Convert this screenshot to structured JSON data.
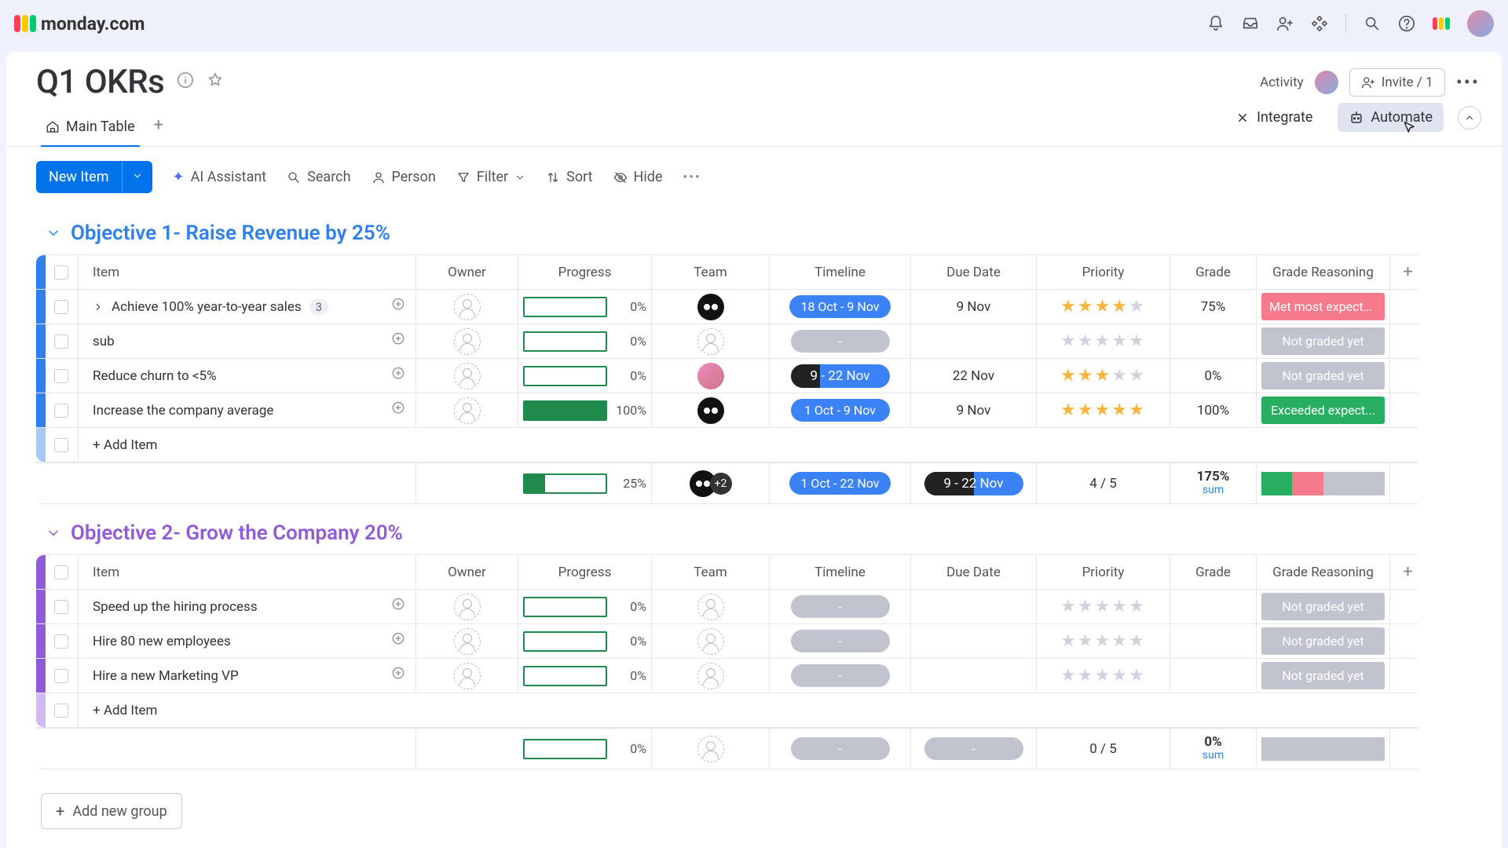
{
  "brand": "monday.com",
  "board": {
    "title": "Q1 OKRs"
  },
  "header": {
    "activity": "Activity",
    "invite": "Invite / 1"
  },
  "tabs": {
    "main": "Main Table",
    "integrate": "Integrate",
    "automate": "Automate"
  },
  "toolbar": {
    "newitem": "New Item",
    "ai": "AI Assistant",
    "search": "Search",
    "person": "Person",
    "filter": "Filter",
    "sort": "Sort",
    "hide": "Hide"
  },
  "cols": {
    "item": "Item",
    "owner": "Owner",
    "progress": "Progress",
    "team": "Team",
    "timeline": "Timeline",
    "due": "Due Date",
    "priority": "Priority",
    "grade": "Grade",
    "reason": "Grade Reasoning"
  },
  "groups": [
    {
      "title": "Objective 1- Raise Revenue by 25%",
      "color": "blue",
      "rows": [
        {
          "name": "Achieve 100% year-to-year sales",
          "sub": "3",
          "expand": true,
          "progress": 0,
          "team": "group",
          "timeline": "18 Oct - 9 Nov",
          "tl_style": "blue",
          "due": "9 Nov",
          "stars": 4,
          "grade": "75%",
          "reason": "Met most expecta...",
          "reason_cls": "pink"
        },
        {
          "name": "sub",
          "progress": 0,
          "team": "ph",
          "timeline": "-",
          "tl_style": "grey",
          "due": "",
          "stars": 0,
          "grade": "",
          "reason": "Not graded yet",
          "reason_cls": "grey"
        },
        {
          "name": "Reduce churn to <5%",
          "progress": 0,
          "team": "person",
          "timeline": "9 - 22 Nov",
          "tl_style": "split",
          "due": "22 Nov",
          "stars": 3,
          "grade": "0%",
          "reason": "Not graded yet",
          "reason_cls": "grey"
        },
        {
          "name": "Increase the company average",
          "progress": 100,
          "team": "group",
          "timeline": "1 Oct - 9 Nov",
          "tl_style": "blue",
          "due": "9 Nov",
          "stars": 5,
          "grade": "100%",
          "reason": "Exceeded expect...",
          "reason_cls": "green"
        }
      ],
      "summary": {
        "progress": 25,
        "team_extra": "+2",
        "timeline": "1 Oct - 22 Nov",
        "due": "9 - 22 Nov",
        "priority": "4  / 5",
        "grade": "175%",
        "grade_sub": "sum"
      }
    },
    {
      "title": "Objective 2- Grow the Company 20%",
      "color": "purple",
      "rows": [
        {
          "name": "Speed up the hiring process",
          "progress": 0,
          "team": "ph",
          "timeline": "-",
          "tl_style": "grey",
          "due": "",
          "stars": 0,
          "grade": "",
          "reason": "Not graded yet",
          "reason_cls": "grey"
        },
        {
          "name": "Hire 80 new employees",
          "progress": 0,
          "team": "ph",
          "timeline": "-",
          "tl_style": "grey",
          "due": "",
          "stars": 0,
          "grade": "",
          "reason": "Not graded yet",
          "reason_cls": "grey"
        },
        {
          "name": "Hire a new Marketing VP",
          "progress": 0,
          "team": "ph",
          "timeline": "-",
          "tl_style": "grey",
          "due": "",
          "stars": 0,
          "grade": "",
          "reason": "Not graded yet",
          "reason_cls": "grey"
        }
      ],
      "summary": {
        "progress": 0,
        "timeline": "-",
        "due": "-",
        "priority": "0  / 5",
        "grade": "0%",
        "grade_sub": "sum"
      }
    }
  ],
  "misc": {
    "additem": "+ Add Item",
    "addgroup": "Add new group"
  }
}
